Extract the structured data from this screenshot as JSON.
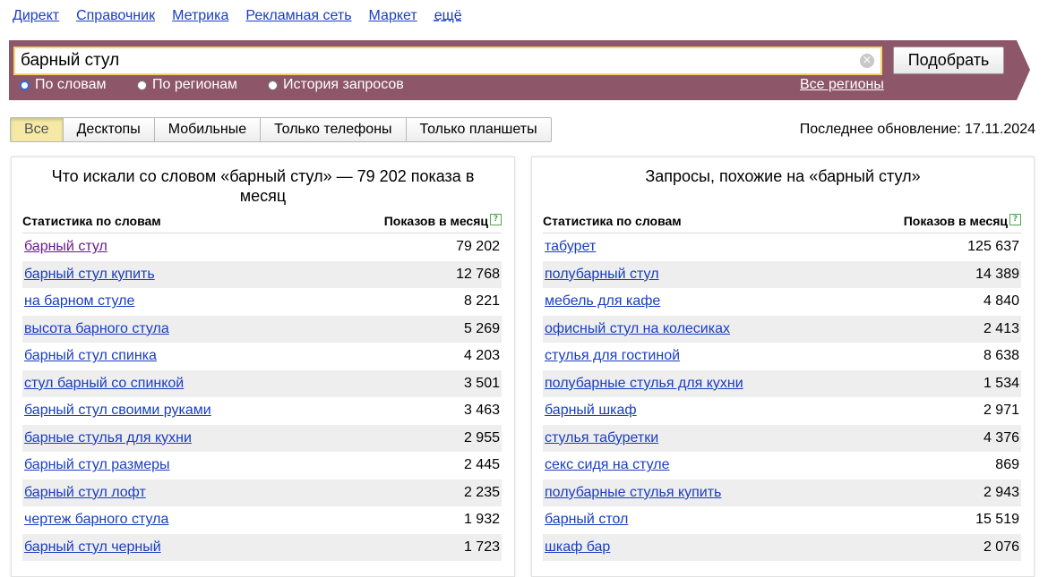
{
  "nav": {
    "items": [
      "Директ",
      "Справочник",
      "Метрика",
      "Рекламная сеть",
      "Маркет"
    ],
    "more": "ещё"
  },
  "search": {
    "value": "барный стул",
    "button": "Подобрать",
    "clear_icon": "×",
    "modes": [
      "По словам",
      "По регионам",
      "История запросов"
    ],
    "selected_mode": "По словам",
    "all_regions": "Все регионы"
  },
  "tabs": [
    "Все",
    "Десктопы",
    "Мобильные",
    "Только телефоны",
    "Только планшеты"
  ],
  "active_tab": "Все",
  "last_update": "Последнее обновление: 17.11.2024",
  "left_panel": {
    "title": "Что искали со словом «барный стул» — 79 202 показа в месяц",
    "col_words": "Статистика по словам",
    "col_count": "Показов в месяц",
    "rows": [
      {
        "phrase": "барный стул",
        "count": "79 202"
      },
      {
        "phrase": "барный стул купить",
        "count": "12 768"
      },
      {
        "phrase": "на барном стуле",
        "count": "8 221"
      },
      {
        "phrase": "высота барного стула",
        "count": "5 269"
      },
      {
        "phrase": "барный стул спинка",
        "count": "4 203"
      },
      {
        "phrase": "стул барный со спинкой",
        "count": "3 501"
      },
      {
        "phrase": "барный стул своими руками",
        "count": "3 463"
      },
      {
        "phrase": "барные стулья для кухни",
        "count": "2 955"
      },
      {
        "phrase": "барный стул размеры",
        "count": "2 445"
      },
      {
        "phrase": "барный стул лофт",
        "count": "2 235"
      },
      {
        "phrase": "чертеж барного стула",
        "count": "1 932"
      },
      {
        "phrase": "барный стул черный",
        "count": "1 723"
      }
    ]
  },
  "right_panel": {
    "title": "Запросы, похожие на «барный стул»",
    "col_words": "Статистика по словам",
    "col_count": "Показов в месяц",
    "rows": [
      {
        "phrase": "табурет",
        "count": "125 637"
      },
      {
        "phrase": "полубарный стул",
        "count": "14 389"
      },
      {
        "phrase": "мебель для кафе",
        "count": "4 840"
      },
      {
        "phrase": "офисный стул на колесиках",
        "count": "2 413"
      },
      {
        "phrase": "стулья для гостиной",
        "count": "8 638"
      },
      {
        "phrase": "полубарные стулья для кухни",
        "count": "1 534"
      },
      {
        "phrase": "барный шкаф",
        "count": "2 971"
      },
      {
        "phrase": "стулья табуретки",
        "count": "4 376"
      },
      {
        "phrase": "секс сидя на стуле",
        "count": "869"
      },
      {
        "phrase": "полубарные стулья купить",
        "count": "2 943"
      },
      {
        "phrase": "барный стол",
        "count": "15 519"
      },
      {
        "phrase": "шкаф бар",
        "count": "2 076"
      }
    ]
  },
  "colors": {
    "link": "#1a3dc1",
    "visited_link": "#661a8e",
    "band": "#8e5769",
    "input_border": "#f2d46a",
    "active_tab": "#f6e9a5",
    "help_icon": "#54a454"
  }
}
